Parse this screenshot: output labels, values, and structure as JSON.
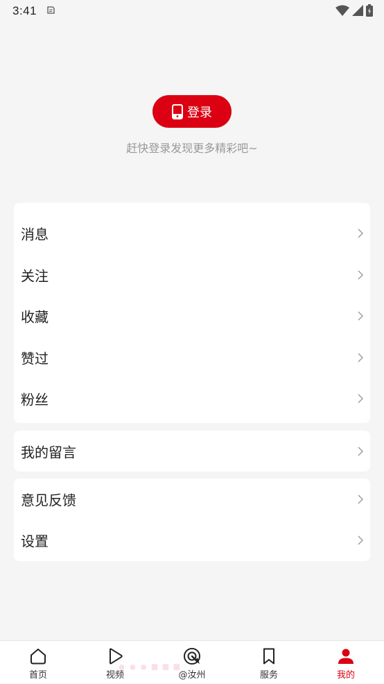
{
  "status_bar": {
    "time": "3:41",
    "icons": [
      "notification-icon",
      "wifi-icon",
      "cellular-icon",
      "battery-icon"
    ]
  },
  "login": {
    "button_label": "登录",
    "hint": "赶快登录发现更多精彩吧~"
  },
  "menu": {
    "group1": [
      {
        "label": "消息"
      },
      {
        "label": "关注"
      },
      {
        "label": "收藏"
      },
      {
        "label": "赞过"
      },
      {
        "label": "粉丝"
      }
    ],
    "group2": [
      {
        "label": "我的留言"
      }
    ],
    "group3": [
      {
        "label": "意见反馈"
      },
      {
        "label": "设置"
      }
    ]
  },
  "bottom_nav": {
    "items": [
      {
        "label": "首页",
        "icon": "home-icon"
      },
      {
        "label": "视频",
        "icon": "play-icon"
      },
      {
        "label": "@汝州",
        "icon": "at-target-icon"
      },
      {
        "label": "服务",
        "icon": "bookmark-icon"
      },
      {
        "label": "我的",
        "icon": "user-icon"
      }
    ],
    "active_index": 4
  },
  "colors": {
    "accent": "#db0012",
    "background": "#f5f5f5",
    "card": "#ffffff",
    "text_secondary": "#999999"
  }
}
